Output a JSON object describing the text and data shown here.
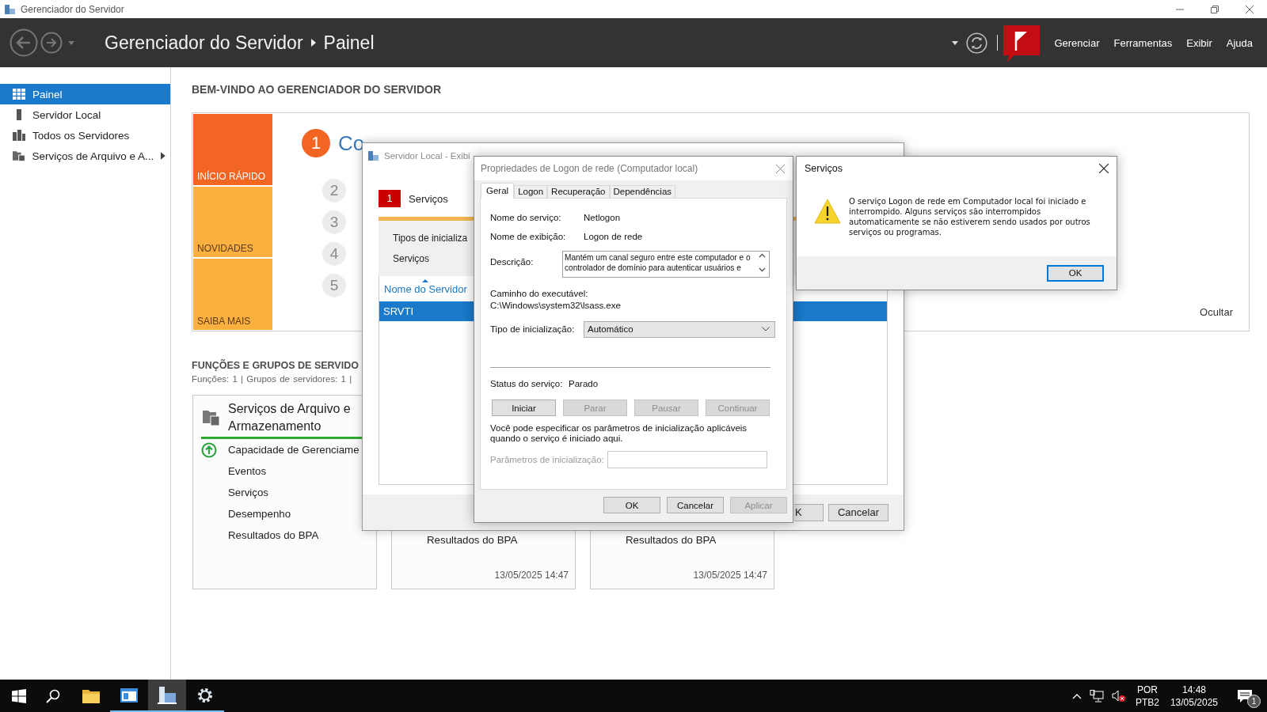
{
  "window": {
    "title": "Gerenciador do Servidor"
  },
  "header": {
    "breadcrumb": [
      "Gerenciador do Servidor",
      "Painel"
    ],
    "menus": [
      "Gerenciar",
      "Ferramentas",
      "Exibir",
      "Ajuda"
    ]
  },
  "sidebar": {
    "items": [
      {
        "label": "Painel",
        "selected": true,
        "expandable": false
      },
      {
        "label": "Servidor Local",
        "selected": false,
        "expandable": false
      },
      {
        "label": "Todos os Servidores",
        "selected": false,
        "expandable": false
      },
      {
        "label": "Serviços de Arquivo e A...",
        "selected": false,
        "expandable": true
      }
    ]
  },
  "welcome": {
    "heading": "BEM-VINDO AO GERENCIADOR DO SERVIDOR",
    "tiles": [
      {
        "label": "INÍCIO RÁPIDO",
        "color": "#f26522"
      },
      {
        "label": "NOVIDADES",
        "color": "#fbb040"
      },
      {
        "label": "SAIBA MAIS",
        "color": "#fbb040"
      }
    ],
    "steps": [
      {
        "number": "1",
        "label": "Co",
        "active": true
      },
      {
        "number": "2",
        "active": false
      },
      {
        "number": "3",
        "active": false
      },
      {
        "number": "4",
        "active": false
      },
      {
        "number": "5",
        "active": false
      }
    ],
    "hide_link": "Ocultar"
  },
  "roles": {
    "heading": "FUNÇÕES E GRUPOS DE SERVIDO",
    "summary": "Funções: 1 | Grupos de servidores: 1 |",
    "cards": [
      {
        "title": "Serviços de Arquivo e Armazenamento",
        "rows": [
          {
            "label": "Capacidade de Gerenciame",
            "kind": "status"
          },
          {
            "label": "Eventos",
            "kind": "plain"
          },
          {
            "label": "Serviços",
            "kind": "plain"
          },
          {
            "label": "Desempenho",
            "kind": "plain"
          },
          {
            "label": "Resultados do BPA",
            "kind": "plain"
          }
        ]
      },
      {
        "rows": [
          {
            "label": "Resultados do BPA"
          }
        ],
        "timestamp": "13/05/2025 14:47"
      },
      {
        "rows": [
          {
            "label": "Resultados do BPA"
          }
        ],
        "timestamp": "13/05/2025 14:47"
      }
    ]
  },
  "details_window": {
    "title": "Servidor Local - Exibi",
    "alert_count": "1",
    "alert_label": "Serviços",
    "filters": [
      "Tipos de inicializa",
      "Serviços"
    ],
    "columns": [
      {
        "label": "Nome do Servidor",
        "sorted": true
      }
    ],
    "rows": [
      {
        "cells": [
          "SRVTI"
        ],
        "selected": true
      }
    ],
    "buttons": [
      "K",
      "Cancelar"
    ]
  },
  "properties_dialog": {
    "title": "Propriedades de Logon de rede (Computador local)",
    "tabs": [
      {
        "label": "Geral",
        "selected": true
      },
      {
        "label": "Logon",
        "selected": false
      },
      {
        "label": "Recuperação",
        "selected": false
      },
      {
        "label": "Dependências",
        "selected": false
      }
    ],
    "fields": [
      {
        "label": "Nome do serviço:",
        "value": "Netlogon"
      },
      {
        "label": "Nome de exibição:",
        "value": "Logon de rede"
      }
    ],
    "description": {
      "label": "Descrição:",
      "text": "Mantém um canal seguro entre este computador e o controlador de domínio para autenticar usuários e"
    },
    "executable": {
      "label": "Caminho do executável:",
      "path": "C:\\Windows\\system32\\lsass.exe"
    },
    "startup_type": {
      "label": "Tipo de inicialização:",
      "value": "Automático"
    },
    "status": {
      "label": "Status do serviço:",
      "value": "Parado"
    },
    "service_buttons": [
      {
        "label": "Iniciar",
        "disabled": false
      },
      {
        "label": "Parar",
        "disabled": true
      },
      {
        "label": "Pausar",
        "disabled": true
      },
      {
        "label": "Continuar",
        "disabled": true
      }
    ],
    "hint": "Você pode especificar os parâmetros de inicialização aplicáveis quando o serviço é iniciado aqui.",
    "params": {
      "label": "Parâmetros de inicialização:",
      "disabled": true
    },
    "buttons": [
      {
        "label": "OK",
        "disabled": false
      },
      {
        "label": "Cancelar",
        "disabled": false
      },
      {
        "label": "Aplicar",
        "disabled": true
      }
    ]
  },
  "message_box": {
    "title": "Serviços",
    "message": "O serviço Logon de rede em Computador local foi iniciado e interrompido. Alguns serviços são interrompidos automaticamente se não estiverem sendo usados por outros serviços ou programas.",
    "button": {
      "label": "OK",
      "focused": true
    }
  },
  "taskbar": {
    "apps": [
      {
        "running": false,
        "selected": false
      },
      {
        "running": true,
        "selected": false
      },
      {
        "running": true,
        "selected": true
      },
      {
        "running": true,
        "selected": false
      }
    ],
    "language": "POR",
    "layout": "PTB2",
    "time": "14:48",
    "date": "13/05/2025",
    "notifications": "1"
  }
}
